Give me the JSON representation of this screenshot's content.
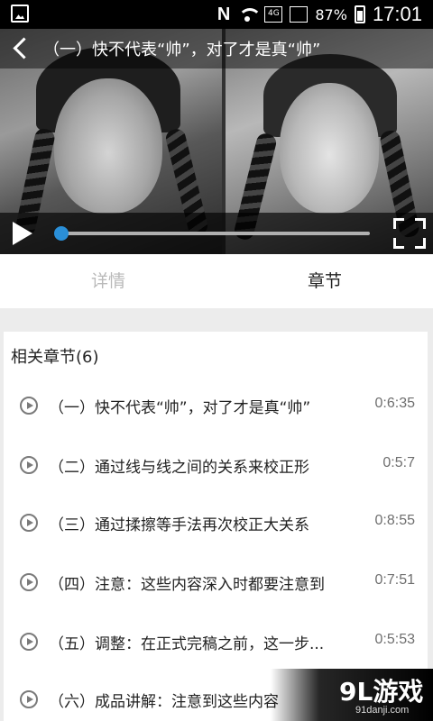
{
  "status_bar": {
    "carrier_icon": "N",
    "signal_label": "4G",
    "battery": "87%",
    "time": "17:01"
  },
  "video": {
    "title": "（一）快不代表“帅”，对了才是真“帅”",
    "progress_fraction": 0.0
  },
  "tabs": [
    {
      "label": "详情",
      "active": false
    },
    {
      "label": "章节",
      "active": true
    }
  ],
  "chapters_section": {
    "title": "相关章节(6)",
    "items": [
      {
        "title": "（一）快不代表“帅”，对了才是真“帅”",
        "duration": "0:6:35"
      },
      {
        "title": "（二）通过线与线之间的关系来校正形",
        "duration": "0:5:7"
      },
      {
        "title": "（三）通过揉擦等手法再次校正大关系",
        "duration": "0:8:55"
      },
      {
        "title": "（四）注意：这些内容深入时都要注意到",
        "duration": "0:7:51"
      },
      {
        "title": "（五）调整：在正式完稿之前，这一步...",
        "duration": "0:5:53"
      },
      {
        "title": "（六）成品讲解：注意到这些内容",
        "duration": ""
      }
    ]
  },
  "watermark": {
    "logo": "9L游戏",
    "site": "91danji.com"
  }
}
